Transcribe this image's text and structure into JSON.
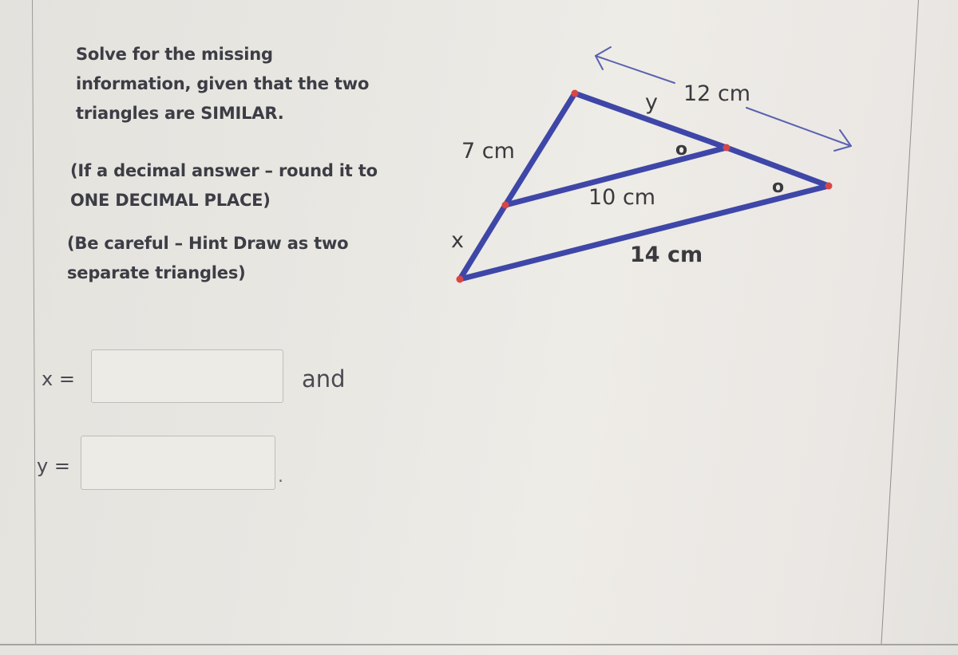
{
  "prompt": {
    "lines_1": [
      "Solve for the missing",
      "information, given that the two",
      "triangles are SIMILAR."
    ],
    "lines_2": [
      "(If a decimal answer – round it to",
      "ONE DECIMAL PLACE)"
    ],
    "lines_3": [
      "(Be careful – Hint Draw as two",
      "separate triangles)"
    ]
  },
  "diagram": {
    "side_labels": {
      "top_left_side": "7 cm",
      "bottom_left_side": "x",
      "top_right_side": "y",
      "outer_right_side": "12 cm",
      "inner_parallel_side": "10 cm",
      "base_side": "14 cm"
    },
    "angle_marks": [
      "o",
      "o"
    ],
    "accent_colors": {
      "segment": "#3e47a8",
      "vertex": "#d94545",
      "arrow": "#5a62b0"
    },
    "arrow_icons": [
      "arrow-up-left-icon",
      "arrow-down-right-icon"
    ]
  },
  "answers": {
    "x_label": "x =",
    "x_value": "",
    "and_text": "and",
    "y_label": "y =",
    "y_value": "",
    "period": "."
  }
}
